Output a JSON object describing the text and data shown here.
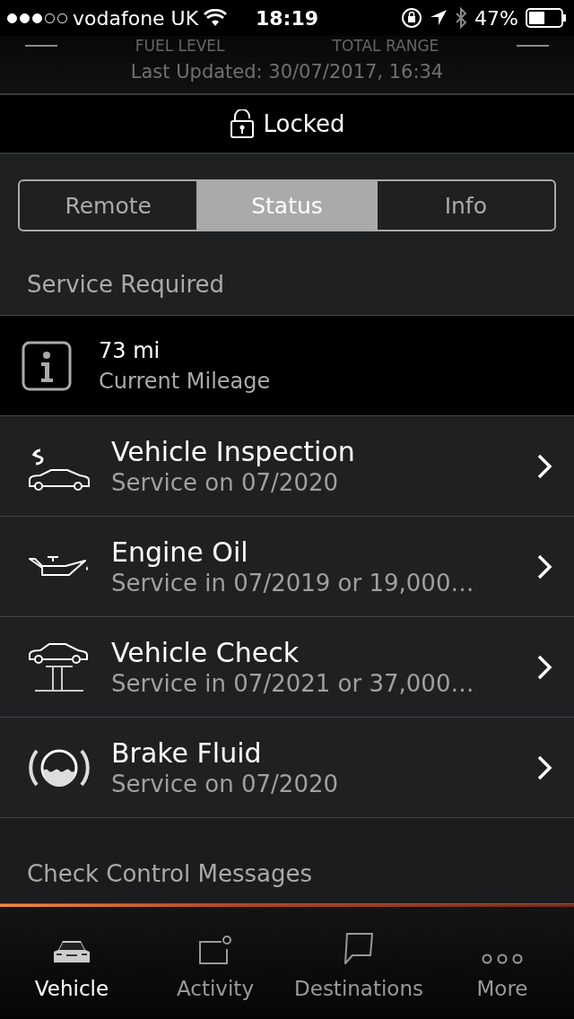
{
  "status_bar": {
    "carrier": "vodafone UK",
    "time": "18:19",
    "battery": "47%"
  },
  "header": {
    "labels": [
      "FUEL LEVEL",
      "TOTAL RANGE"
    ],
    "last_updated": "Last Updated: 30/07/2017, 16:34"
  },
  "lock_status": {
    "label": "Locked"
  },
  "tabs": [
    {
      "label": "Remote",
      "selected": false
    },
    {
      "label": "Status",
      "selected": true
    },
    {
      "label": "Info",
      "selected": false
    }
  ],
  "service_section": {
    "title": "Service Required",
    "mileage": {
      "value": "73 mi",
      "label": "Current Mileage"
    },
    "items": [
      {
        "kind": "inspection",
        "title": "Vehicle Inspection",
        "detail": "Service on 07/2020"
      },
      {
        "kind": "oil",
        "title": "Engine Oil",
        "detail": "Service in 07/2019 or 19,000…"
      },
      {
        "kind": "check",
        "title": "Vehicle Check",
        "detail": "Service in 07/2021 or 37,000…"
      },
      {
        "kind": "brake",
        "title": "Brake Fluid",
        "detail": "Service on 07/2020"
      }
    ]
  },
  "check_control_section": {
    "title": "Check Control Messages"
  },
  "tab_bar": [
    {
      "kind": "vehicle",
      "label": "Vehicle",
      "selected": true
    },
    {
      "kind": "activity",
      "label": "Activity",
      "selected": false
    },
    {
      "kind": "destinations",
      "label": "Destinations",
      "selected": false
    },
    {
      "kind": "more",
      "label": "More",
      "selected": false
    }
  ]
}
